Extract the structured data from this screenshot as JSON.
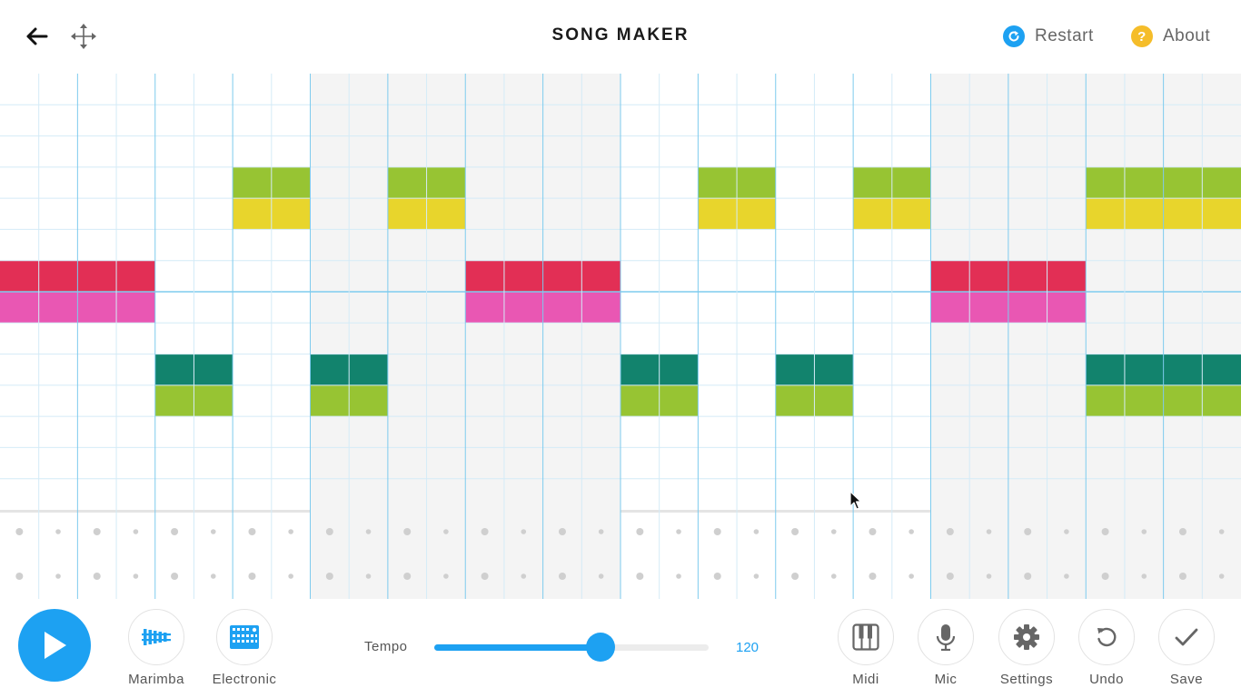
{
  "header": {
    "title": "SONG MAKER",
    "restart_label": "Restart",
    "about_label": "About",
    "back_icon": "arrow-left-icon",
    "move_icon": "move-arrows-icon",
    "restart_icon": "refresh-icon",
    "about_icon": "question-icon"
  },
  "grid": {
    "columns": 32,
    "rows": 14,
    "beats_per_bar": 2,
    "shaded_bars": [
      4,
      5,
      6,
      7,
      12,
      13,
      14,
      15
    ],
    "octave_divider_after_row": 7,
    "notes": [
      {
        "row": 3,
        "cols": [
          6,
          7,
          10,
          11,
          18,
          19,
          22,
          23,
          28,
          29,
          30,
          31
        ],
        "color": "#97c433"
      },
      {
        "row": 4,
        "cols": [
          6,
          7,
          10,
          11,
          18,
          19,
          22,
          23,
          28,
          29,
          30,
          31
        ],
        "color": "#e8d52c"
      },
      {
        "row": 6,
        "cols": [
          0,
          1,
          2,
          3,
          12,
          13,
          14,
          15,
          24,
          25,
          26,
          27
        ],
        "color": "#e22f55"
      },
      {
        "row": 7,
        "cols": [
          0,
          1,
          2,
          3,
          12,
          13,
          14,
          15,
          24,
          25,
          26,
          27
        ],
        "color": "#e957b3"
      },
      {
        "row": 9,
        "cols": [
          4,
          5,
          8,
          9,
          16,
          17,
          20,
          21,
          28,
          29,
          30,
          31
        ],
        "color": "#12836d"
      },
      {
        "row": 10,
        "cols": [
          4,
          5,
          8,
          9,
          16,
          17,
          20,
          21,
          28,
          29,
          30,
          31
        ],
        "color": "#97c433"
      }
    ]
  },
  "percussion": {
    "rows": 2,
    "active": []
  },
  "colors": {
    "accent": "#1da1f2",
    "about_icon_bg": "#f5bd2a",
    "grid_line": "#d4ebf7",
    "bar_line": "#7ecbee",
    "shaded_bg": "#f4f4f4"
  },
  "footer": {
    "play_icon": "play-icon",
    "instrument": {
      "label": "Marimba",
      "icon": "marimba-icon"
    },
    "percussion_instrument": {
      "label": "Electronic",
      "icon": "drum-machine-icon"
    },
    "tempo_label": "Tempo",
    "tempo_value": "120",
    "tempo_fraction": 0.605,
    "midi": {
      "label": "Midi",
      "icon": "piano-keys-icon"
    },
    "mic": {
      "label": "Mic",
      "icon": "microphone-icon"
    },
    "settings": {
      "label": "Settings",
      "icon": "gear-icon"
    },
    "undo": {
      "label": "Undo",
      "icon": "undo-icon"
    },
    "save": {
      "label": "Save",
      "icon": "checkmark-icon"
    }
  }
}
